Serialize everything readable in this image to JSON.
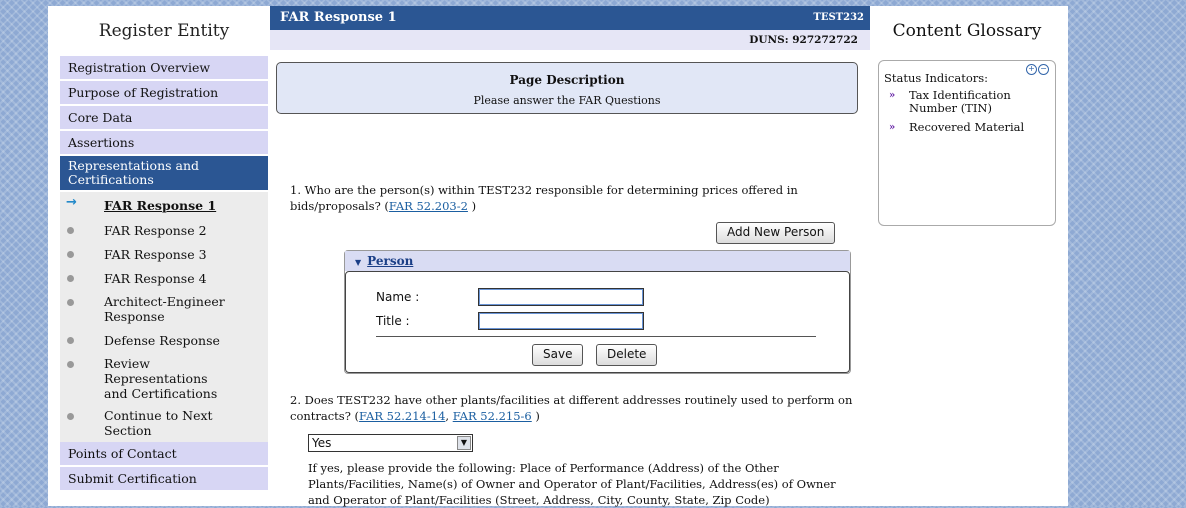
{
  "left": {
    "title": "Register Entity",
    "items_top": [
      "Registration Overview",
      "Purpose of Registration",
      "Core Data",
      "Assertions"
    ],
    "active": "Representations and Certifications",
    "sub_items": [
      "FAR Response 1",
      "FAR Response 2",
      "FAR Response 3",
      "FAR Response 4",
      "Architect-Engineer Response",
      "Defense Response",
      "Review Representations and Certifications",
      "Continue to Next Section"
    ],
    "items_bottom": [
      "Points of Contact",
      "Submit Certification"
    ]
  },
  "center": {
    "title": "FAR Response 1",
    "entity": "TEST232",
    "duns": "DUNS: 927272722",
    "page_desc_title": "Page Description",
    "page_desc_text": "Please answer the FAR Questions",
    "q1_text": "1. Who are the person(s) within TEST232 responsible for determining prices offered in bids/proposals? (",
    "q1_link": "FAR 52.203-2",
    "q1_end": " )",
    "add_person": "Add New Person",
    "person_header": "Person",
    "name_label": "Name :",
    "title_label": "Title :",
    "name_value": "",
    "title_value": "",
    "save": "Save",
    "delete": "Delete",
    "q2_text": "2. Does TEST232 have other plants/facilities at different addresses routinely used to perform on contracts? (",
    "q2_link1": "FAR 52.214-14",
    "q2_sep": ", ",
    "q2_link2": "FAR 52.215-6",
    "q2_end": " )",
    "q2_selected": "Yes",
    "q2_followup": "If yes, please provide the following: Place of Performance (Address) of the Other Plants/Facilities, Name(s) of Owner and Operator of Plant/Facilities, Address(es) of Owner and Operator of Plant/Facilities (Street, Address, City, County, State, Zip Code)"
  },
  "right": {
    "title": "Content Glossary",
    "heading": "Status Indicators:",
    "items": [
      "Tax Identification Number (TIN)",
      "Recovered Material"
    ],
    "expand": "+",
    "collapse": "−"
  }
}
